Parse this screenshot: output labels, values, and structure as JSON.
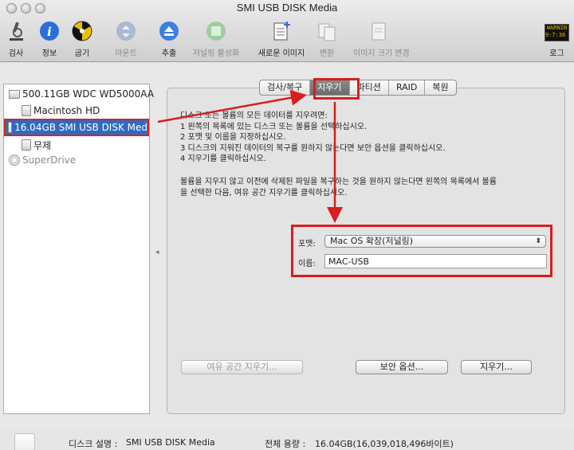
{
  "window": {
    "title": "SMI USB DISK Media"
  },
  "toolbar": {
    "items": [
      {
        "label": "검사",
        "icon": "microscope-icon"
      },
      {
        "label": "정보",
        "icon": "info-icon"
      },
      {
        "label": "굽기",
        "icon": "burn-icon"
      },
      {
        "label": "마운트",
        "icon": "mount-icon"
      },
      {
        "label": "추출",
        "icon": "eject-icon"
      },
      {
        "label": "저널링 활성화",
        "icon": "journaling-icon"
      },
      {
        "label": "새로운 이미지",
        "icon": "new-image-icon"
      },
      {
        "label": "변환",
        "icon": "convert-icon"
      },
      {
        "label": "이미지 크기 변경",
        "icon": "resize-image-icon"
      },
      {
        "label": "로그",
        "icon": "log-icon"
      }
    ],
    "log_icon_text": "WARNIN\n9:7:36 8"
  },
  "sidebar": {
    "items": [
      {
        "label": "500.11GB WDC WD5000AA"
      },
      {
        "label": "Macintosh HD"
      },
      {
        "label": "16.04GB SMI USB DISK Med"
      },
      {
        "label": "무제"
      },
      {
        "label": "SuperDrive"
      }
    ]
  },
  "tabs": [
    "검사/복구",
    "지우기",
    "파티션",
    "RAID",
    "복원"
  ],
  "description": {
    "lines": [
      "디스크 또는 볼륨의 모든 데이터를 지우려면:",
      "1 왼쪽의 목록에 있는 디스크 또는 볼륨을 선택하십시오.",
      "2 포맷 및 이름을 지정하십시오.",
      "3 디스크의 지워진 데이터의 복구를 원하지 않는다면 보안 옵션을 클릭하십시오.",
      "4 지우기를 클릭하십시오."
    ],
    "note_lines": [
      "볼륨을 지우지 않고 이전에 삭제된 파일을 복구하는 것을 원하지 않는다면 왼쪽의 목록에서 볼륨",
      "을 선택한 다음, 여유 공간 지우기를 클릭하십시오."
    ]
  },
  "form": {
    "format_label": "포맷:",
    "format_value": "Mac OS 확장(저널링)",
    "name_label": "이름:",
    "name_value": "MAC-USB"
  },
  "buttons": {
    "erase_free_space": "여유 공간 지우기...",
    "security_options": "보안 옵션...",
    "erase": "지우기..."
  },
  "status": {
    "desc_label": "디스크 설명 :",
    "desc_value": "SMI USB DISK Media",
    "capacity_label": "전체 용량 :",
    "capacity_value": "16.04GB(16,039,018,496바이트)"
  },
  "colors": {
    "highlight": "#d81e1e",
    "selection": "#2f6ac2"
  }
}
